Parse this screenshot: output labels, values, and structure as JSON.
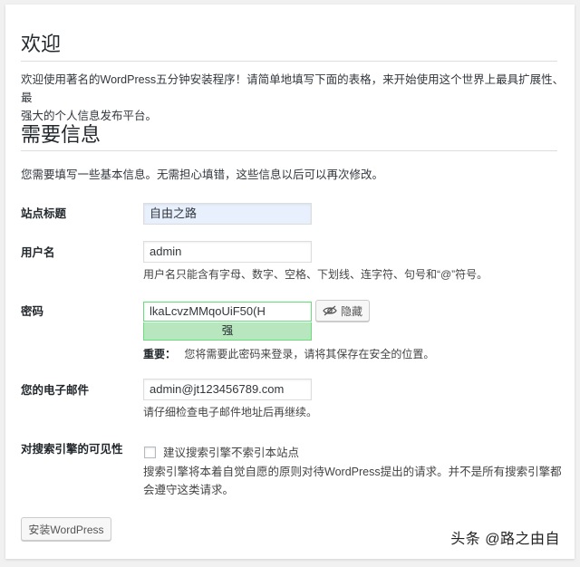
{
  "welcome": {
    "title": "欢迎",
    "intro_line1": "欢迎使用著名的WordPress五分钟安装程序！请简单地填写下面的表格，来开始使用这个世界上最具扩展性、最",
    "intro_line2": "强大的个人信息发布平台。"
  },
  "info": {
    "title": "需要信息",
    "description": "您需要填写一些基本信息。无需担心填错，这些信息以后可以再次修改。"
  },
  "site_title": {
    "label": "站点标题",
    "value": "自由之路"
  },
  "username": {
    "label": "用户名",
    "value": "admin",
    "hint": "用户名只能含有字母、数字、空格、下划线、连字符、句号和“@”符号。"
  },
  "password": {
    "label": "密码",
    "value": "lkaLcvzMMqoUiF50(H",
    "hide_label": "隐藏",
    "strength": "强",
    "important_label": "重要：",
    "important_text": "您将需要此密码来登录，请将其保存在安全的位置。"
  },
  "email": {
    "label": "您的电子邮件",
    "value": "admin@jt123456789.com",
    "hint": "请仔细检查电子邮件地址后再继续。"
  },
  "visibility": {
    "label": "对搜索引擎的可见性",
    "checkbox_label": "建议搜索引擎不索引本站点",
    "checked": false,
    "note_line1": "搜索引擎将本着自觉自愿的原则对待WordPress提出的请求。并不是所有搜索引擎都",
    "note_line2": "会遵守这类请求。"
  },
  "install_button": "安装WordPress",
  "watermark": "头条 @路之由自"
}
